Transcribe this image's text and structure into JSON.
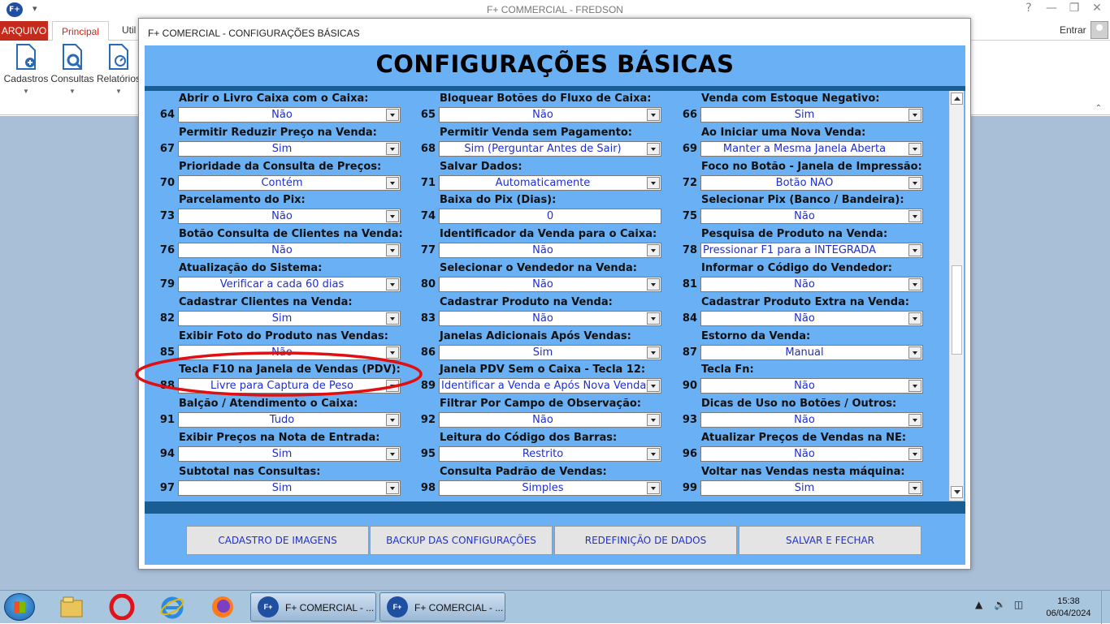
{
  "app": {
    "title": "F+ COMMERCIAL - FREDSON",
    "logo_text": "F+",
    "window_controls": [
      "?",
      "—",
      "❐",
      "✕"
    ]
  },
  "ribbon": {
    "tabs": {
      "arquivo": "ARQUIVO",
      "principal": "Principal",
      "util": "Util"
    },
    "entrar": "Entrar",
    "buttons": [
      {
        "label": "Cadastros",
        "icon": "user-file-icon"
      },
      {
        "label": "Consultas",
        "icon": "search-file-icon"
      },
      {
        "label": "Relatórios",
        "icon": "report-file-icon"
      }
    ]
  },
  "dialog": {
    "title": "F+ COMERCIAL - CONFIGURAÇÕES BÁSICAS",
    "header": "CONFIGURAÇÕES BÁSICAS",
    "settings": [
      {
        "num": "64",
        "label": "Abrir o Livro Caixa com o Caixa:",
        "value": "Não"
      },
      {
        "num": "65",
        "label": "Bloquear Botões do Fluxo de Caixa:",
        "value": "Não"
      },
      {
        "num": "66",
        "label": "Venda com Estoque Negativo:",
        "value": "Sim"
      },
      {
        "num": "67",
        "label": "Permitir Reduzir Preço na Venda:",
        "value": "Sim"
      },
      {
        "num": "68",
        "label": "Permitir Venda sem Pagamento:",
        "value": "Sim (Perguntar Antes de Sair)"
      },
      {
        "num": "69",
        "label": "Ao Iniciar uma Nova Venda:",
        "value": "Manter a Mesma Janela Aberta"
      },
      {
        "num": "70",
        "label": "Prioridade da Consulta de Preços:",
        "value": "Contém"
      },
      {
        "num": "71",
        "label": "Salvar Dados:",
        "value": "Automaticamente"
      },
      {
        "num": "72",
        "label": "Foco no Botão - Janela de Impressão:",
        "value": "Botão NÃO"
      },
      {
        "num": "73",
        "label": "Parcelamento do Pix:",
        "value": "Não"
      },
      {
        "num": "74",
        "label": "Baixa do Pix (Dias):",
        "value": "0"
      },
      {
        "num": "75",
        "label": "Selecionar Pix (Banco / Bandeira):",
        "value": "Não"
      },
      {
        "num": "76",
        "label": "Botão Consulta de Clientes na Venda:",
        "value": "Não"
      },
      {
        "num": "77",
        "label": "Identificador da Venda para o Caixa:",
        "value": "Não"
      },
      {
        "num": "78",
        "label": "Pesquisa de Produto na Venda:",
        "value": "Pressionar F1 para a INTEGRADA"
      },
      {
        "num": "79",
        "label": "Atualização do Sistema:",
        "value": "Verificar a cada 60 dias"
      },
      {
        "num": "80",
        "label": "Selecionar o Vendedor na Venda:",
        "value": "Não"
      },
      {
        "num": "81",
        "label": "Informar o Código do Vendedor:",
        "value": "Não"
      },
      {
        "num": "82",
        "label": "Cadastrar Clientes na Venda:",
        "value": "Sim"
      },
      {
        "num": "83",
        "label": "Cadastrar Produto na Venda:",
        "value": "Não"
      },
      {
        "num": "84",
        "label": "Cadastrar Produto Extra na Venda:",
        "value": "Não"
      },
      {
        "num": "85",
        "label": "Exibir Foto do Produto nas Vendas:",
        "value": "Não"
      },
      {
        "num": "86",
        "label": "Janelas Adicionais Após Vendas:",
        "value": "Sim"
      },
      {
        "num": "87",
        "label": "Estorno da Venda:",
        "value": "Manual"
      },
      {
        "num": "88",
        "label": "Tecla F10 na Janela de Vendas (PDV):",
        "value": "Livre para Captura de Peso"
      },
      {
        "num": "89",
        "label": "Janela PDV Sem o Caixa - Tecla 12:",
        "value": "Identificar a Venda e Após Nova Venda"
      },
      {
        "num": "90",
        "label": "Tecla Fn:",
        "value": "Não"
      },
      {
        "num": "91",
        "label": "Balção / Atendimento o Caixa:",
        "value": "Tudo"
      },
      {
        "num": "92",
        "label": "Filtrar Por Campo de Observação:",
        "value": "Não"
      },
      {
        "num": "93",
        "label": "Dicas de Uso no Botões / Outros:",
        "value": "Não"
      },
      {
        "num": "94",
        "label": "Exibir Preços na Nota de Entrada:",
        "value": "Sim"
      },
      {
        "num": "95",
        "label": "Leitura do Código dos Barras:",
        "value": "Restrito"
      },
      {
        "num": "96",
        "label": "Atualizar Preços de Vendas na NE:",
        "value": "Não"
      },
      {
        "num": "97",
        "label": "Subtotal nas Consultas:",
        "value": "Sim"
      },
      {
        "num": "98",
        "label": "Consulta Padrão de Vendas:",
        "value": "Simples"
      },
      {
        "num": "99",
        "label": "Voltar nas Vendas nesta máquina:",
        "value": "Sim"
      }
    ],
    "buttons": {
      "images": "CADASTRO DE IMAGENS",
      "backup": "BACKUP DAS CONFIGURAÇÕES",
      "reset": "REDEFINIÇÃO DE DADOS",
      "save_close": "SALVAR E FECHAR"
    },
    "highlight_color": "#e01010"
  },
  "taskbar": {
    "pinned": [
      "windows-explorer-icon",
      "opera-icon",
      "internet-explorer-icon",
      "firefox-icon"
    ],
    "tasks": [
      {
        "logo": "F+",
        "label": "F+ COMERCIAL - ..."
      },
      {
        "logo": "F+",
        "label": "F+ COMERCIAL - ..."
      }
    ],
    "time": "15:38",
    "date": "06/04/2024"
  }
}
